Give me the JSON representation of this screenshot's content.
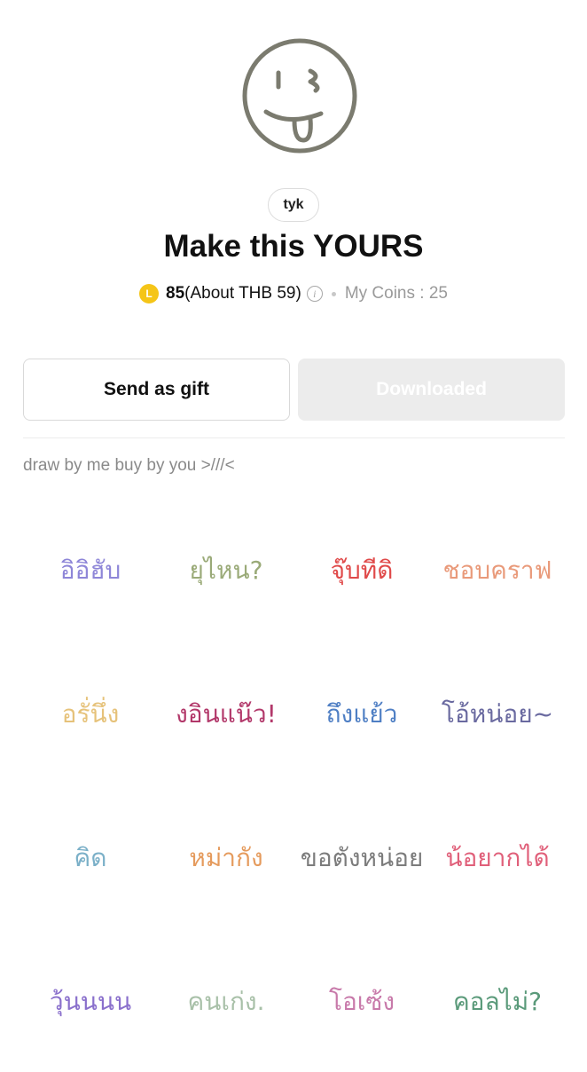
{
  "creator": {
    "name": "tyk"
  },
  "title": "Make this YOURS",
  "price": {
    "coin_icon": "line-coin-icon",
    "coin_letter": "L",
    "amount": "85",
    "approx": "(About THB 59)",
    "info_icon": "info-icon",
    "my_coins": "My Coins : 25"
  },
  "buttons": {
    "gift": "Send as gift",
    "download": "Downloaded"
  },
  "description": "draw by me buy by you >///<",
  "colors": {
    "coin": "#f5c518",
    "hero_stroke": "#7b7b6f",
    "muted": "#8a8a8a"
  },
  "stickers": [
    {
      "text": "อิอิฮับ",
      "color": "#8e86d8"
    },
    {
      "text": "ยุไหน?",
      "color": "#9aaa78"
    },
    {
      "text": "จุ๊บทีดิ",
      "color": "#e04a4a"
    },
    {
      "text": "ชอบคราฟ",
      "color": "#e99a7a"
    },
    {
      "text": "อรั่นึ่ง",
      "color": "#e6c27a"
    },
    {
      "text": "งอินแน๊ว!",
      "color": "#b2386a"
    },
    {
      "text": "ถึงแย้ว",
      "color": "#4f7fc4"
    },
    {
      "text": "โอ้หน่อย~",
      "color": "#6a6aa0"
    },
    {
      "text": "คิด",
      "color": "#7bb0c8"
    },
    {
      "text": "หม่ากัง",
      "color": "#e59b5d"
    },
    {
      "text": "ขอตังหน่อย",
      "color": "#7c7c7c"
    },
    {
      "text": "น้อยากได้",
      "color": "#e0607a"
    },
    {
      "text": "วุ้นนนน",
      "color": "#8a70cc"
    },
    {
      "text": "คนเก่ง.",
      "color": "#a8c0a8"
    },
    {
      "text": "โอเซ้ง",
      "color": "#c87aaa"
    },
    {
      "text": "คอลไม่?",
      "color": "#5a9a7a"
    }
  ]
}
